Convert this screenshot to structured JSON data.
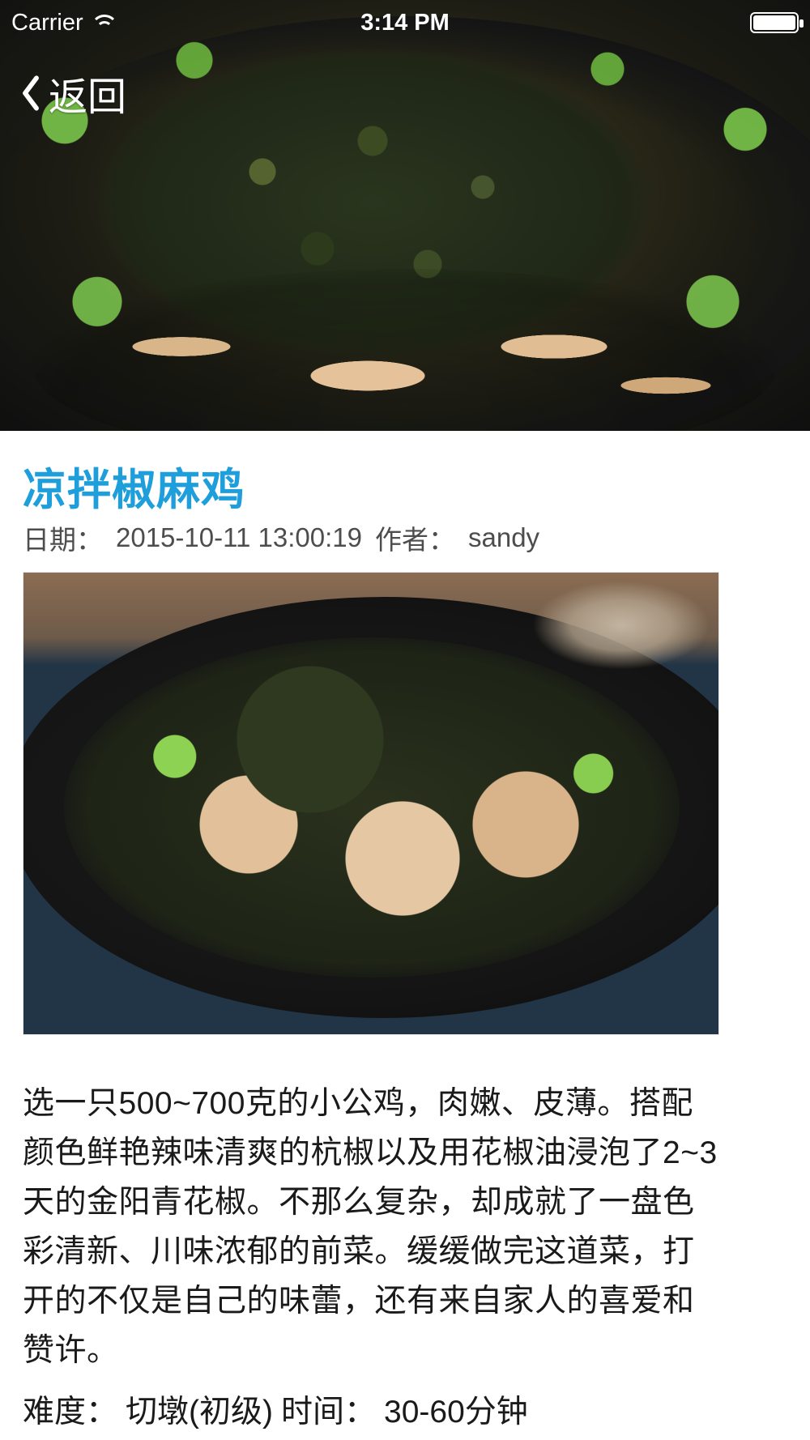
{
  "status_bar": {
    "carrier": "Carrier",
    "time": "3:14 PM"
  },
  "nav": {
    "back_label": "返回",
    "chevron_icon": "chevron-left-icon"
  },
  "article": {
    "title": "凉拌椒麻鸡",
    "date_label": "日期：",
    "date_value": "2015-10-11 13:00:19",
    "author_label": "作者：",
    "author_value": "sandy",
    "description": "选一只500~700克的小公鸡，肉嫩、皮薄。搭配颜色鲜艳辣味清爽的杭椒以及用花椒油浸泡了2~3天的金阳青花椒。不那么复杂，却成就了一盘色彩清新、川味浓郁的前菜。缓缓做完这道菜，打开的不仅是自己的味蕾，还有来自家人的喜爱和赞许。",
    "difficulty_label": "难度：",
    "difficulty_value": "切墩(初级)",
    "time_label": "时间：",
    "time_value": "30-60分钟"
  },
  "colors": {
    "title": "#1e9fdc",
    "text": "#1a1a1a",
    "meta": "#4d4d4d"
  },
  "icons": {
    "wifi": "wifi-icon",
    "battery": "battery-icon"
  }
}
